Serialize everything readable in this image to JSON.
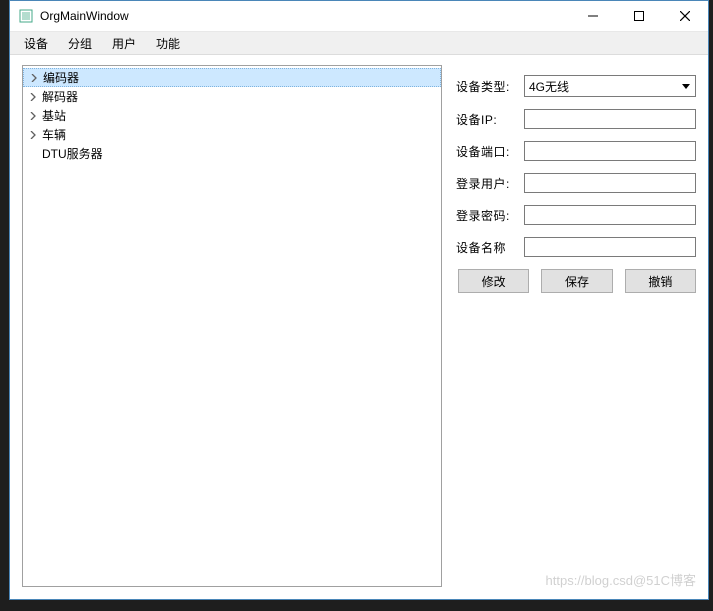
{
  "window": {
    "title": "OrgMainWindow"
  },
  "menu": {
    "items": [
      "设备",
      "分组",
      "用户",
      "功能"
    ]
  },
  "tree": {
    "items": [
      {
        "label": "编码器",
        "expandable": true,
        "selected": true
      },
      {
        "label": "解码器",
        "expandable": true,
        "selected": false
      },
      {
        "label": "基站",
        "expandable": true,
        "selected": false
      },
      {
        "label": "车辆",
        "expandable": true,
        "selected": false
      },
      {
        "label": "DTU服务器",
        "expandable": false,
        "selected": false
      }
    ]
  },
  "form": {
    "device_type": {
      "label": "设备类型:",
      "value": "4G无线"
    },
    "device_ip": {
      "label": "设备IP:",
      "value": ""
    },
    "device_port": {
      "label": "设备端口:",
      "value": ""
    },
    "login_user": {
      "label": "登录用户:",
      "value": ""
    },
    "login_pwd": {
      "label": "登录密码:",
      "value": ""
    },
    "device_name": {
      "label": "设备名称",
      "value": ""
    }
  },
  "buttons": {
    "modify": "修改",
    "save": "保存",
    "cancel": "撤销"
  },
  "watermark": "https://blog.csd@51C博客"
}
